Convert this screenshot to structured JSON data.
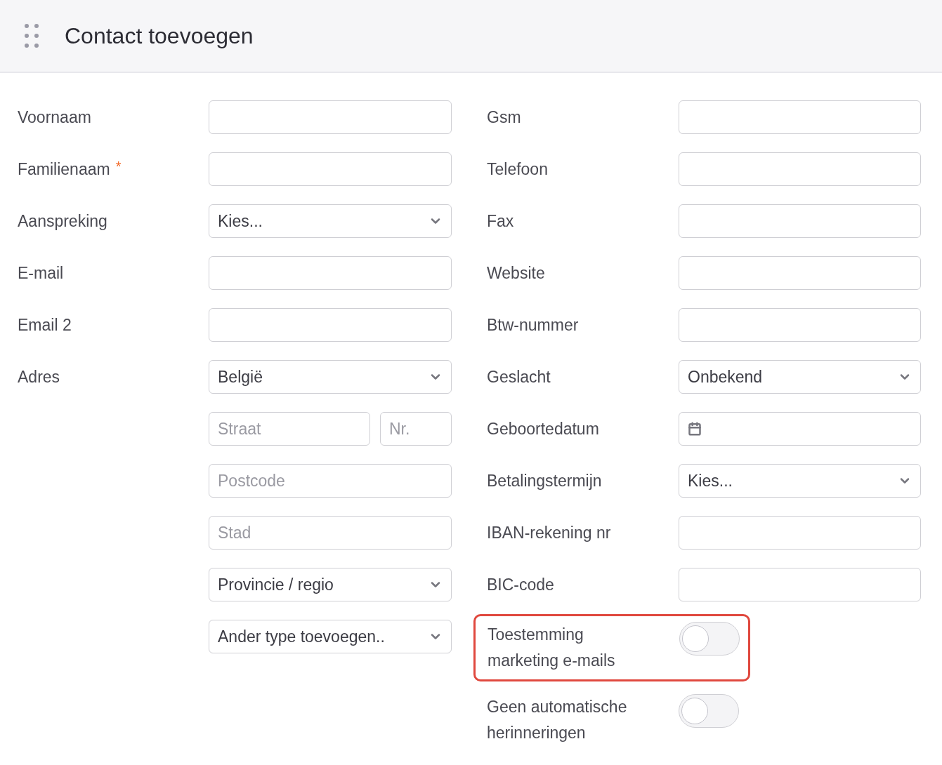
{
  "header": {
    "title": "Contact toevoegen"
  },
  "left": [
    {
      "label": "Voornaam",
      "controls": [
        [
          {
            "kind": "input"
          }
        ]
      ]
    },
    {
      "label": "Familienaam",
      "required_mark": "*",
      "controls": [
        [
          {
            "kind": "input"
          }
        ]
      ]
    },
    {
      "label": "Aanspreking",
      "controls": [
        [
          {
            "kind": "select",
            "value": "Kies..."
          }
        ]
      ]
    },
    {
      "label": "E-mail",
      "controls": [
        [
          {
            "kind": "input"
          }
        ]
      ]
    },
    {
      "label": "Email 2",
      "controls": [
        [
          {
            "kind": "input"
          }
        ]
      ]
    },
    {
      "label": "Adres",
      "controls": [
        [
          {
            "kind": "select",
            "value": "België"
          }
        ],
        [
          {
            "kind": "input",
            "placeholder": "Straat"
          },
          {
            "kind": "input",
            "placeholder": "Nr."
          }
        ],
        [
          {
            "kind": "input",
            "placeholder": "Postcode"
          }
        ],
        [
          {
            "kind": "input",
            "placeholder": "Stad"
          }
        ],
        [
          {
            "kind": "select",
            "value": "Provincie / regio"
          }
        ],
        [
          {
            "kind": "select",
            "value": "Ander type toevoegen.."
          }
        ]
      ]
    }
  ],
  "right": [
    {
      "kind": "field",
      "label": "Gsm",
      "control": {
        "kind": "input"
      }
    },
    {
      "kind": "field",
      "label": "Telefoon",
      "control": {
        "kind": "input"
      }
    },
    {
      "kind": "field",
      "label": "Fax",
      "control": {
        "kind": "input"
      }
    },
    {
      "kind": "field",
      "label": "Website",
      "control": {
        "kind": "input"
      }
    },
    {
      "kind": "field",
      "label": "Btw-nummer",
      "control": {
        "kind": "input"
      }
    },
    {
      "kind": "field",
      "label": "Geslacht",
      "control": {
        "kind": "select",
        "value": "Onbekend"
      }
    },
    {
      "kind": "field",
      "label": "Geboortedatum",
      "control": {
        "kind": "date"
      }
    },
    {
      "kind": "field",
      "label": "Betalingstermijn",
      "control": {
        "kind": "select",
        "value": "Kies..."
      }
    },
    {
      "kind": "field",
      "label": "IBAN-rekening nr",
      "control": {
        "kind": "input"
      }
    },
    {
      "kind": "field",
      "label": "BIC-code",
      "control": {
        "kind": "input"
      }
    },
    {
      "kind": "toggle",
      "label": "Toestemming marketing e-mails",
      "on": false,
      "highlighted": true
    },
    {
      "kind": "toggle",
      "label": "Geen automatische herinneringen",
      "on": false,
      "highlighted": false
    }
  ]
}
